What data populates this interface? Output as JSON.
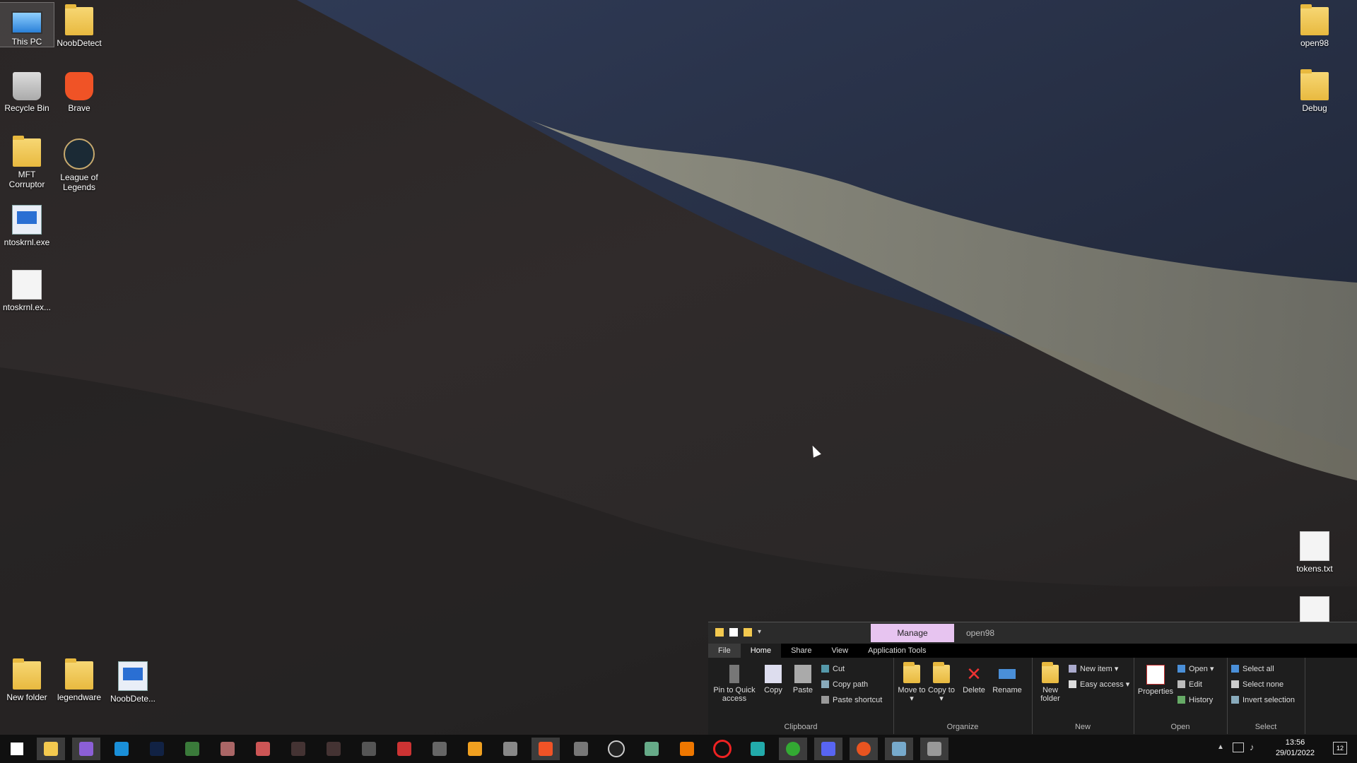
{
  "desktop": {
    "icons": [
      {
        "label": "This PC",
        "icon": "computer-icon"
      },
      {
        "label": "NoobDetect",
        "icon": "folder-icon"
      },
      {
        "label": "Recycle Bin",
        "icon": "recycle-bin-icon"
      },
      {
        "label": "Brave",
        "icon": "brave-browser-icon"
      },
      {
        "label": "MFT Corruptor",
        "icon": "folder-icon"
      },
      {
        "label": "League of Legends",
        "icon": "league-of-legends-icon"
      },
      {
        "label": "ntoskrnl.exe",
        "icon": "executable-icon"
      },
      {
        "label": "ntoskrnl.ex...",
        "icon": "file-icon"
      },
      {
        "label": "open98",
        "icon": "zip-folder-icon"
      },
      {
        "label": "Debug",
        "icon": "zip-folder-icon"
      },
      {
        "label": "tokens.txt",
        "icon": "text-file-icon"
      },
      {
        "label": "New folder",
        "icon": "folder-icon"
      },
      {
        "label": "legendware",
        "icon": "zip-folder-icon"
      },
      {
        "label": "NoobDete...",
        "icon": "executable-icon"
      }
    ]
  },
  "explorer": {
    "manage_tab": "Manage",
    "window_title": "open98",
    "tabs": [
      "File",
      "Home",
      "Share",
      "View",
      "Application Tools"
    ],
    "clipboard": {
      "pin": "Pin to Quick access",
      "copy": "Copy",
      "paste": "Paste",
      "cut": "Cut",
      "copy_path": "Copy path",
      "paste_shortcut": "Paste shortcut",
      "label": "Clipboard"
    },
    "organize": {
      "move_to": "Move to",
      "copy_to": "Copy to",
      "delete": "Delete",
      "rename": "Rename",
      "label": "Organize"
    },
    "new_group": {
      "new_folder": "New folder",
      "new_item": "New item",
      "easy_access": "Easy access",
      "label": "New"
    },
    "open_group": {
      "properties": "Properties",
      "open": "Open",
      "edit": "Edit",
      "history": "History",
      "label": "Open"
    },
    "select_group": {
      "select_all": "Select all",
      "select_none": "Select none",
      "invert_selection": "Invert selection",
      "label": "Select"
    }
  },
  "taskbar": {
    "apps": [
      "start-icon",
      "file-explorer-icon",
      "visual-studio-icon",
      "app-icon",
      "app-icon",
      "app-icon",
      "app-icon",
      "app-icon",
      "app-icon",
      "app-icon",
      "app-icon",
      "app-icon",
      "app-icon",
      "app-icon",
      "brave-icon",
      "calculator-icon",
      "obs-icon",
      "app-icon",
      "app-icon",
      "opera-icon",
      "app-icon",
      "xbox-icon",
      "discord-icon",
      "ubuntu-icon",
      "notepad-icon",
      "app-icon"
    ],
    "time": "13:56",
    "date": "29/01/2022",
    "notifications": "12"
  }
}
